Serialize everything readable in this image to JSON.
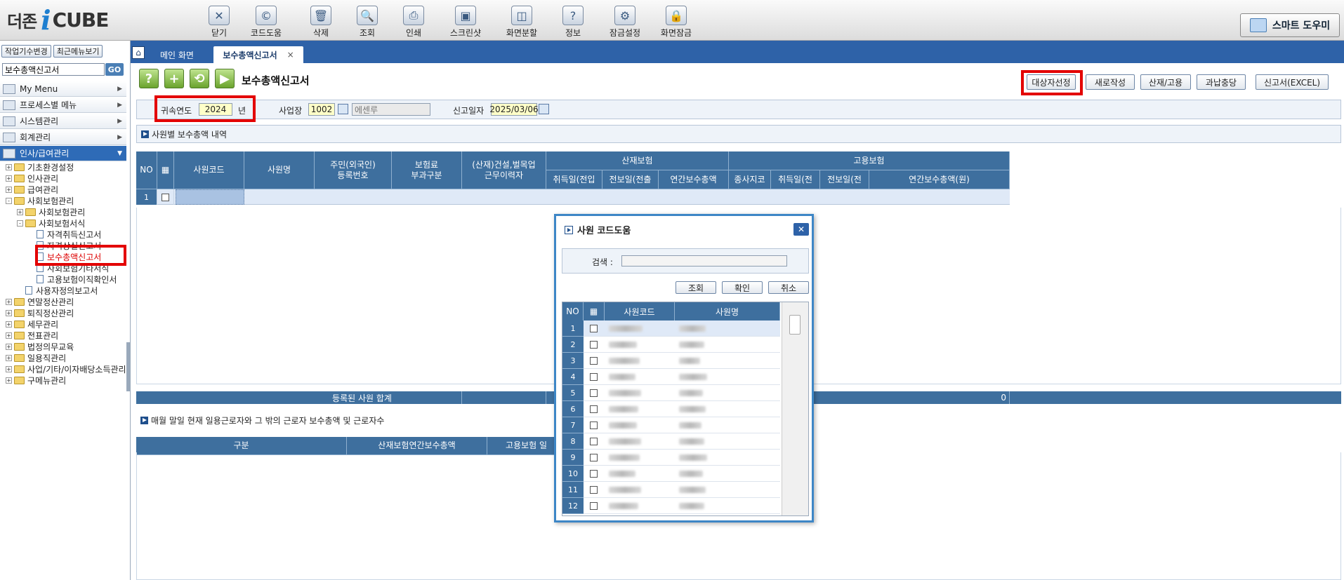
{
  "logo": {
    "brand_ko": "더존",
    "i_mark": "i",
    "brand_en": "CUBE"
  },
  "toolbar": [
    {
      "label": "닫기",
      "icon": "close-window-icon",
      "glyph": "✕"
    },
    {
      "label": "코드도움",
      "icon": "code-help-icon",
      "glyph": "©"
    },
    {
      "label": "삭제",
      "icon": "delete-icon",
      "glyph": "🗑"
    },
    {
      "label": "조회",
      "icon": "search-icon",
      "glyph": "🔍"
    },
    {
      "label": "인쇄",
      "icon": "print-icon",
      "glyph": "⎙"
    },
    {
      "label": "스크린샷",
      "icon": "screenshot-icon",
      "glyph": "▣"
    },
    {
      "label": "화면분할",
      "icon": "split-screen-icon",
      "glyph": "◫"
    },
    {
      "label": "정보",
      "icon": "info-icon",
      "glyph": "?"
    },
    {
      "label": "잠금설정",
      "icon": "lock-settings-icon",
      "glyph": "⚙"
    },
    {
      "label": "화면잠금",
      "icon": "screen-lock-icon",
      "glyph": "🔒"
    }
  ],
  "smart_help": "스마트 도우미",
  "sidebar": {
    "btn_change_period": "작업기수변경",
    "btn_recent_menu": "최근메뉴보기",
    "search_value": "보수총액신고서",
    "go_label": "GO",
    "menus": [
      "My Menu",
      "프로세스별 메뉴",
      "시스템관리",
      "회계관리",
      "인사/급여관리"
    ],
    "tree": [
      {
        "label": "기초환경설정",
        "level": 0,
        "type": "folder",
        "exp": "+"
      },
      {
        "label": "인사관리",
        "level": 0,
        "type": "folder",
        "exp": "+"
      },
      {
        "label": "급여관리",
        "level": 0,
        "type": "folder",
        "exp": "+"
      },
      {
        "label": "사회보험관리",
        "level": 0,
        "type": "folder",
        "exp": "-"
      },
      {
        "label": "사회보험관리",
        "level": 1,
        "type": "folder",
        "exp": "+"
      },
      {
        "label": "사회보험서식",
        "level": 1,
        "type": "folder",
        "exp": "-"
      },
      {
        "label": "자격취득신고서",
        "level": 2,
        "type": "doc",
        "exp": ""
      },
      {
        "label": "자격상실신고서",
        "level": 2,
        "type": "doc",
        "exp": ""
      },
      {
        "label": "보수총액신고서",
        "level": 2,
        "type": "doc",
        "exp": "",
        "selected": true
      },
      {
        "label": "사회보험기타서식",
        "level": 2,
        "type": "doc",
        "exp": ""
      },
      {
        "label": "고용보험이직확인서",
        "level": 2,
        "type": "doc",
        "exp": ""
      },
      {
        "label": "사용자정의보고서",
        "level": 1,
        "type": "doc",
        "exp": ""
      },
      {
        "label": "연말정산관리",
        "level": 0,
        "type": "folder",
        "exp": "+"
      },
      {
        "label": "퇴직정산관리",
        "level": 0,
        "type": "folder",
        "exp": "+"
      },
      {
        "label": "세무관리",
        "level": 0,
        "type": "folder",
        "exp": "+"
      },
      {
        "label": "전표관리",
        "level": 0,
        "type": "folder",
        "exp": "+"
      },
      {
        "label": "법정의무교육",
        "level": 0,
        "type": "folder",
        "exp": "+"
      },
      {
        "label": "일용직관리",
        "level": 0,
        "type": "folder",
        "exp": "+"
      },
      {
        "label": "사업/기타/이자배당소득관리",
        "level": 0,
        "type": "folder",
        "exp": "+"
      },
      {
        "label": "구메뉴관리",
        "level": 0,
        "type": "folder",
        "exp": "+"
      }
    ]
  },
  "tabs": {
    "home": "메인 화면",
    "active": "보수총액신고서",
    "close": "×"
  },
  "page": {
    "title": "보수총액신고서",
    "buttons": [
      "대상자선정",
      "새로작성",
      "산재/고용",
      "과납충당",
      "신고서(EXCEL)"
    ],
    "filters": {
      "year_label": "귀속연도",
      "year_value": "2024",
      "year_suffix": "년",
      "site_label": "사업장",
      "site_code": "1002",
      "site_name": "에센루",
      "report_date_label": "신고일자",
      "report_date": "2025/03/06"
    },
    "section1": "사원별 보수총액 내역",
    "section2": "매월 말일 현재 일용근로자와 그 밖의 근로자 보수총액 및 근로자수",
    "grid1_headers": {
      "no": "NO",
      "code": "사원코드",
      "name": "사원명",
      "ssn": "주민(외국인)\n등록번호",
      "premium": "보험료\n부과구분",
      "construction": "(산재)건설,벌목업\n근무이력자",
      "industrial": "산재보험",
      "employment": "고용보험",
      "ind_acq": "취득일(전입",
      "ind_loss": "전보일(전출",
      "ind_total": "연간보수총액",
      "emp_branch": "종사지코",
      "emp_acq": "취득일(전",
      "emp_loss": "전보일(전",
      "emp_total": "연간보수총액(원)"
    },
    "grid1_row": {
      "no": "1"
    },
    "sum_label": "등록된 사원 합계",
    "sum_value": "0",
    "grid2_headers": [
      "구분",
      "산재보험연간보수총액",
      "고용보험 일"
    ]
  },
  "modal": {
    "title": "사원 코드도움",
    "close": "✕",
    "search_label": "검색 :",
    "buttons": [
      "조회",
      "확인",
      "취소"
    ],
    "headers": [
      "NO",
      "사원코드",
      "사원명"
    ],
    "rows": [
      "1",
      "2",
      "3",
      "4",
      "5",
      "6",
      "7",
      "8",
      "9",
      "10",
      "11",
      "12"
    ]
  }
}
